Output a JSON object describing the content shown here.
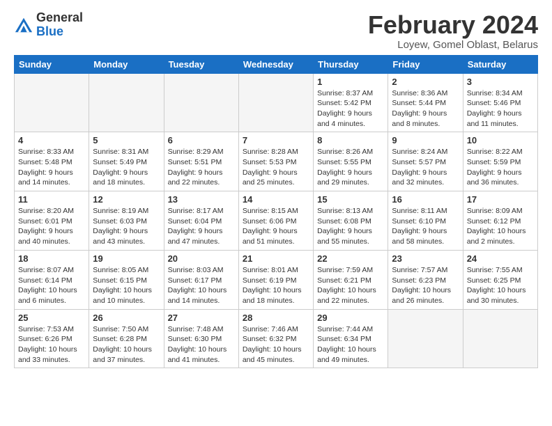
{
  "logo": {
    "general": "General",
    "blue": "Blue"
  },
  "title": "February 2024",
  "location": "Loyew, Gomel Oblast, Belarus",
  "weekdays": [
    "Sunday",
    "Monday",
    "Tuesday",
    "Wednesday",
    "Thursday",
    "Friday",
    "Saturday"
  ],
  "weeks": [
    [
      {
        "day": "",
        "info": ""
      },
      {
        "day": "",
        "info": ""
      },
      {
        "day": "",
        "info": ""
      },
      {
        "day": "",
        "info": ""
      },
      {
        "day": "1",
        "info": "Sunrise: 8:37 AM\nSunset: 5:42 PM\nDaylight: 9 hours and 4 minutes."
      },
      {
        "day": "2",
        "info": "Sunrise: 8:36 AM\nSunset: 5:44 PM\nDaylight: 9 hours and 8 minutes."
      },
      {
        "day": "3",
        "info": "Sunrise: 8:34 AM\nSunset: 5:46 PM\nDaylight: 9 hours and 11 minutes."
      }
    ],
    [
      {
        "day": "4",
        "info": "Sunrise: 8:33 AM\nSunset: 5:48 PM\nDaylight: 9 hours and 14 minutes."
      },
      {
        "day": "5",
        "info": "Sunrise: 8:31 AM\nSunset: 5:49 PM\nDaylight: 9 hours and 18 minutes."
      },
      {
        "day": "6",
        "info": "Sunrise: 8:29 AM\nSunset: 5:51 PM\nDaylight: 9 hours and 22 minutes."
      },
      {
        "day": "7",
        "info": "Sunrise: 8:28 AM\nSunset: 5:53 PM\nDaylight: 9 hours and 25 minutes."
      },
      {
        "day": "8",
        "info": "Sunrise: 8:26 AM\nSunset: 5:55 PM\nDaylight: 9 hours and 29 minutes."
      },
      {
        "day": "9",
        "info": "Sunrise: 8:24 AM\nSunset: 5:57 PM\nDaylight: 9 hours and 32 minutes."
      },
      {
        "day": "10",
        "info": "Sunrise: 8:22 AM\nSunset: 5:59 PM\nDaylight: 9 hours and 36 minutes."
      }
    ],
    [
      {
        "day": "11",
        "info": "Sunrise: 8:20 AM\nSunset: 6:01 PM\nDaylight: 9 hours and 40 minutes."
      },
      {
        "day": "12",
        "info": "Sunrise: 8:19 AM\nSunset: 6:03 PM\nDaylight: 9 hours and 43 minutes."
      },
      {
        "day": "13",
        "info": "Sunrise: 8:17 AM\nSunset: 6:04 PM\nDaylight: 9 hours and 47 minutes."
      },
      {
        "day": "14",
        "info": "Sunrise: 8:15 AM\nSunset: 6:06 PM\nDaylight: 9 hours and 51 minutes."
      },
      {
        "day": "15",
        "info": "Sunrise: 8:13 AM\nSunset: 6:08 PM\nDaylight: 9 hours and 55 minutes."
      },
      {
        "day": "16",
        "info": "Sunrise: 8:11 AM\nSunset: 6:10 PM\nDaylight: 9 hours and 58 minutes."
      },
      {
        "day": "17",
        "info": "Sunrise: 8:09 AM\nSunset: 6:12 PM\nDaylight: 10 hours and 2 minutes."
      }
    ],
    [
      {
        "day": "18",
        "info": "Sunrise: 8:07 AM\nSunset: 6:14 PM\nDaylight: 10 hours and 6 minutes."
      },
      {
        "day": "19",
        "info": "Sunrise: 8:05 AM\nSunset: 6:15 PM\nDaylight: 10 hours and 10 minutes."
      },
      {
        "day": "20",
        "info": "Sunrise: 8:03 AM\nSunset: 6:17 PM\nDaylight: 10 hours and 14 minutes."
      },
      {
        "day": "21",
        "info": "Sunrise: 8:01 AM\nSunset: 6:19 PM\nDaylight: 10 hours and 18 minutes."
      },
      {
        "day": "22",
        "info": "Sunrise: 7:59 AM\nSunset: 6:21 PM\nDaylight: 10 hours and 22 minutes."
      },
      {
        "day": "23",
        "info": "Sunrise: 7:57 AM\nSunset: 6:23 PM\nDaylight: 10 hours and 26 minutes."
      },
      {
        "day": "24",
        "info": "Sunrise: 7:55 AM\nSunset: 6:25 PM\nDaylight: 10 hours and 30 minutes."
      }
    ],
    [
      {
        "day": "25",
        "info": "Sunrise: 7:53 AM\nSunset: 6:26 PM\nDaylight: 10 hours and 33 minutes."
      },
      {
        "day": "26",
        "info": "Sunrise: 7:50 AM\nSunset: 6:28 PM\nDaylight: 10 hours and 37 minutes."
      },
      {
        "day": "27",
        "info": "Sunrise: 7:48 AM\nSunset: 6:30 PM\nDaylight: 10 hours and 41 minutes."
      },
      {
        "day": "28",
        "info": "Sunrise: 7:46 AM\nSunset: 6:32 PM\nDaylight: 10 hours and 45 minutes."
      },
      {
        "day": "29",
        "info": "Sunrise: 7:44 AM\nSunset: 6:34 PM\nDaylight: 10 hours and 49 minutes."
      },
      {
        "day": "",
        "info": ""
      },
      {
        "day": "",
        "info": ""
      }
    ]
  ]
}
